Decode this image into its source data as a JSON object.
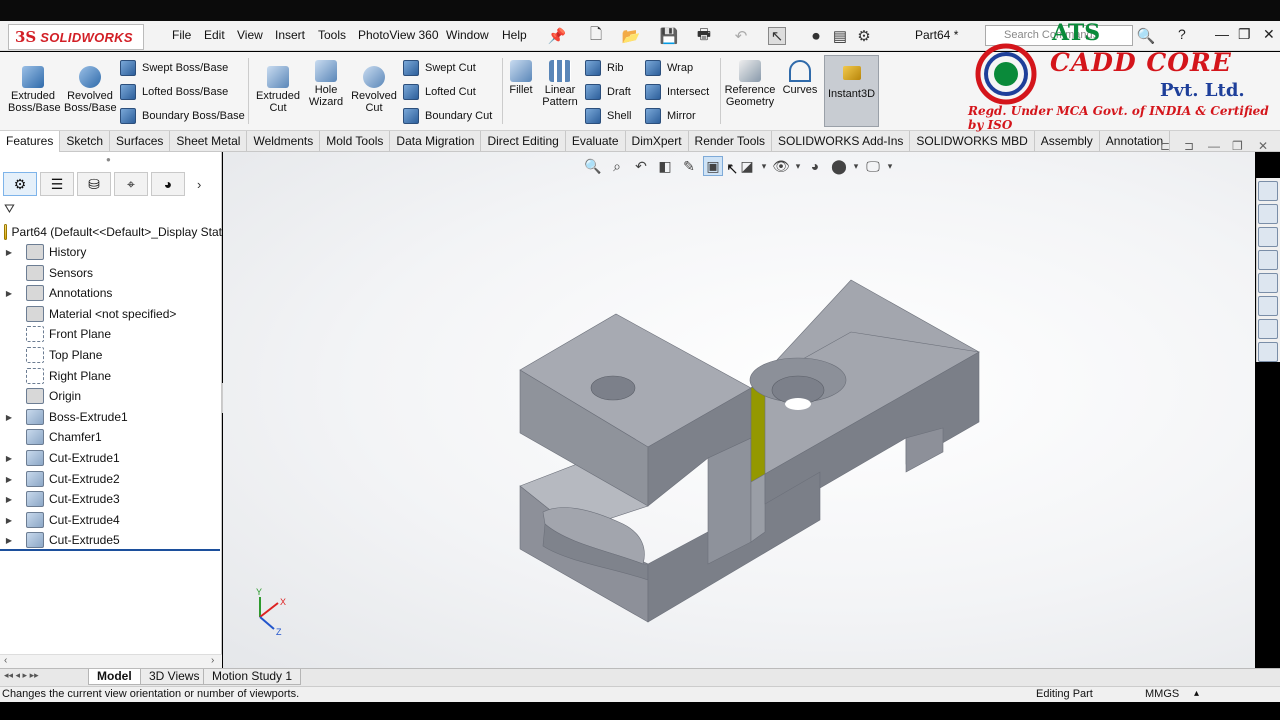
{
  "app": {
    "logo_text": "SOLIDWORKS",
    "logo_prefix": "3S",
    "part_title": "Part64 *"
  },
  "menu": [
    "File",
    "Edit",
    "View",
    "Insert",
    "Tools",
    "PhotoView 360",
    "Window",
    "Help"
  ],
  "search": {
    "placeholder": "Search Commands"
  },
  "ribbon": {
    "extruded_boss": "Extruded\nBoss/Base",
    "revolved_boss": "Revolved\nBoss/Base",
    "swept_boss": "Swept Boss/Base",
    "lofted_boss": "Lofted Boss/Base",
    "boundary_boss": "Boundary Boss/Base",
    "extruded_cut": "Extruded\nCut",
    "hole_wizard": "Hole\nWizard",
    "revolved_cut": "Revolved\nCut",
    "swept_cut": "Swept Cut",
    "lofted_cut": "Lofted Cut",
    "boundary_cut": "Boundary Cut",
    "fillet": "Fillet",
    "linear_pattern": "Linear\nPattern",
    "rib": "Rib",
    "draft": "Draft",
    "shell": "Shell",
    "wrap": "Wrap",
    "intersect": "Intersect",
    "mirror": "Mirror",
    "reference_geometry": "Reference\nGeometry",
    "curves": "Curves",
    "instant3d": "Instant3D"
  },
  "tabs": [
    "Features",
    "Sketch",
    "Surfaces",
    "Sheet Metal",
    "Weldments",
    "Mold Tools",
    "Data Migration",
    "Direct Editing",
    "Evaluate",
    "DimXpert",
    "Render Tools",
    "SOLIDWORKS Add-Ins",
    "SOLIDWORKS MBD",
    "Assembly",
    "Annotation"
  ],
  "tree": {
    "root": "Part64  (Default<<Default>_Display Stat",
    "items": [
      {
        "label": "History",
        "expandable": true,
        "icon": "folder"
      },
      {
        "label": "Sensors",
        "expandable": false,
        "icon": "folder"
      },
      {
        "label": "Annotations",
        "expandable": true,
        "icon": "folder"
      },
      {
        "label": "Material <not specified>",
        "expandable": false,
        "icon": "material"
      },
      {
        "label": "Front Plane",
        "expandable": false,
        "icon": "plane"
      },
      {
        "label": "Top Plane",
        "expandable": false,
        "icon": "plane"
      },
      {
        "label": "Right Plane",
        "expandable": false,
        "icon": "plane"
      },
      {
        "label": "Origin",
        "expandable": false,
        "icon": "origin"
      },
      {
        "label": "Boss-Extrude1",
        "expandable": true,
        "icon": "feature"
      },
      {
        "label": "Chamfer1",
        "expandable": false,
        "icon": "feature"
      },
      {
        "label": "Cut-Extrude1",
        "expandable": true,
        "icon": "feature"
      },
      {
        "label": "Cut-Extrude2",
        "expandable": true,
        "icon": "feature"
      },
      {
        "label": "Cut-Extrude3",
        "expandable": true,
        "icon": "feature"
      },
      {
        "label": "Cut-Extrude4",
        "expandable": true,
        "icon": "feature"
      },
      {
        "label": "Cut-Extrude5",
        "expandable": true,
        "icon": "feature"
      }
    ]
  },
  "bottom_tabs": [
    "Model",
    "3D Views",
    "Motion Study 1"
  ],
  "status": {
    "message": "Changes the current view orientation or number of viewports.",
    "mode": "Editing Part",
    "units": "MMGS"
  },
  "triad": {
    "x": "X",
    "y": "Y",
    "z": "Z"
  },
  "watermark": {
    "ats": "ATS",
    "company": "CADD CORE",
    "pvt": "Pvt. Ltd.",
    "reg": "Regd. Under MCA Govt. of INDIA & Certified by ISO"
  },
  "colors": {
    "part": "#8a8f99",
    "accent_blue": "#1c4f9c",
    "brand_red": "#d4151b"
  }
}
